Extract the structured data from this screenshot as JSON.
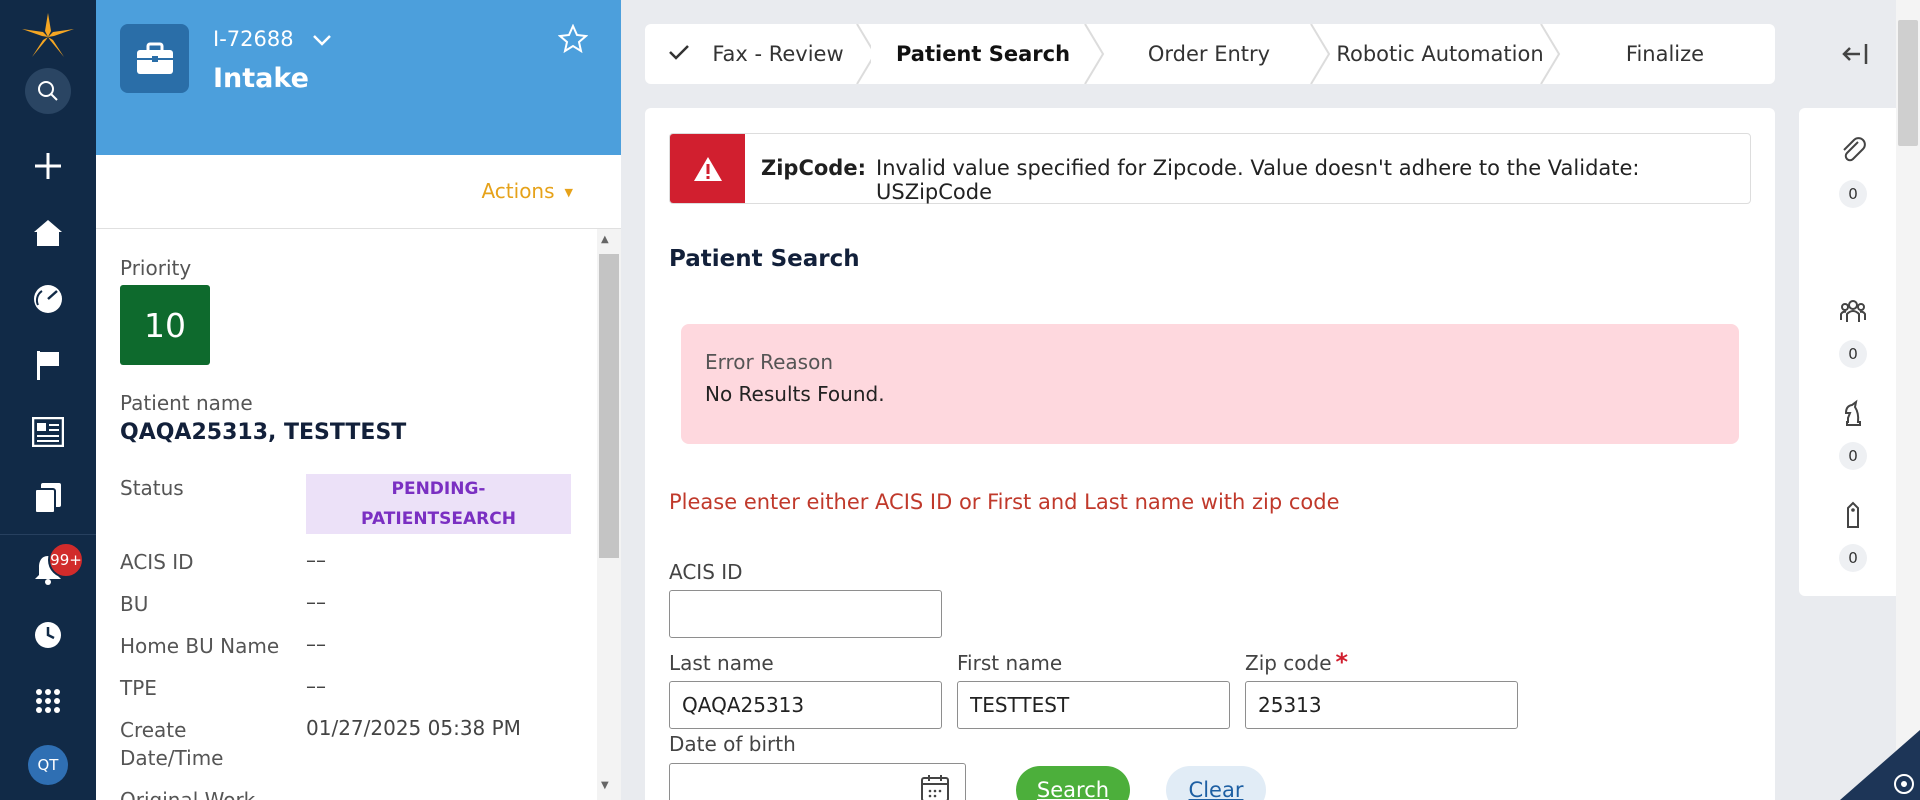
{
  "rail": {
    "notification_count": "99+",
    "avatar_initials": "QT",
    "icons": [
      "logo-icon",
      "search-icon",
      "plus-icon",
      "home-icon",
      "dashboard-icon",
      "flag-icon",
      "news-icon",
      "documents-icon",
      "bell-icon",
      "history-icon",
      "apps-grid-icon"
    ]
  },
  "case": {
    "id": "I-72688",
    "title": "Intake",
    "actions_label": "Actions",
    "priority_label": "Priority",
    "priority_value": "10",
    "patient_name_label": "Patient name",
    "patient_name": "QAQA25313, TESTTEST",
    "fields": [
      {
        "label": "Status",
        "value": "PENDING-PATIENTSEARCH"
      },
      {
        "label": "ACIS ID",
        "value": "––"
      },
      {
        "label": "BU",
        "value": "––"
      },
      {
        "label": "Home BU Name",
        "value": "––"
      },
      {
        "label": "TPE",
        "value": "––"
      },
      {
        "label": "Create Date/Time",
        "value": "01/27/2025 05:38 PM"
      },
      {
        "label": "Original Work",
        "value": ""
      }
    ],
    "status_line1": "PENDING-",
    "status_line2": "PATIENTSEARCH",
    "create_label_line1": "Create",
    "create_label_line2": "Date/Time"
  },
  "stages": [
    {
      "label": "Fax - Review",
      "state": "done"
    },
    {
      "label": "Patient Search",
      "state": "active"
    },
    {
      "label": "Order Entry",
      "state": "pending"
    },
    {
      "label": "Robotic Automation",
      "state": "pending"
    },
    {
      "label": "Finalize",
      "state": "pending"
    }
  ],
  "main": {
    "error_key": "ZipCode:",
    "error_message": "Invalid value specified for Zipcode. Value doesn't adhere to the Validate: USZipCode",
    "section_title": "Patient Search",
    "reason_label": "Error Reason",
    "reason_value": "No Results Found.",
    "help_text": "Please enter either ACIS ID or First and Last name with zip code",
    "form": {
      "acis_label": "ACIS ID",
      "acis_value": "",
      "last_label": "Last name",
      "last_value": "QAQA25313",
      "first_label": "First name",
      "first_value": "TESTTEST",
      "zip_label": "Zip code",
      "zip_required": "*",
      "zip_value": "25313",
      "dob_label": "Date of birth",
      "dob_value": ""
    },
    "search_button": "Search",
    "clear_button": "Clear"
  },
  "utility": {
    "items": [
      {
        "icon": "attachment-icon",
        "count": "0"
      },
      {
        "icon": "people-icon",
        "count": "0"
      },
      {
        "icon": "chess-knight-icon",
        "count": "0"
      },
      {
        "icon": "tag-icon",
        "count": "0"
      }
    ]
  },
  "colors": {
    "rail": "#112a47",
    "header": "#4c9fdc",
    "priority": "#0e6a2d",
    "error": "#d11f2f",
    "reason_bg": "#fed8de",
    "search_btn": "#4caf3b",
    "actions": "#e6a21a"
  }
}
